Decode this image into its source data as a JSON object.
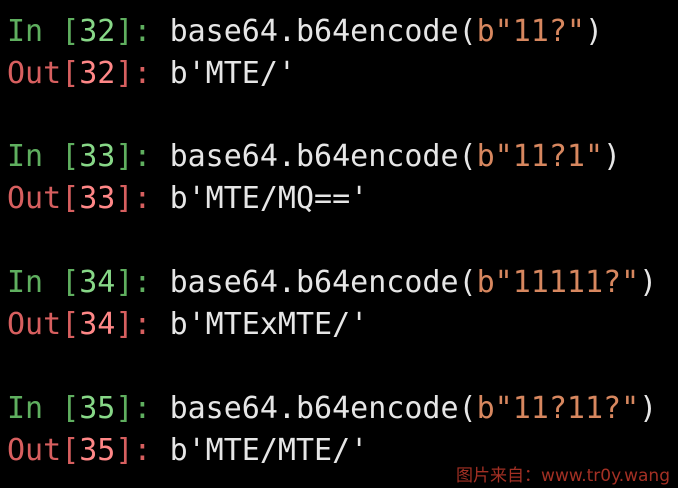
{
  "colors": {
    "background": "#000000",
    "prompt_in": "#5faf5f",
    "prompt_in_number": "#87d787",
    "prompt_out": "#d75f5f",
    "prompt_out_number": "#ff8787",
    "code": "#e6e6e6",
    "string_literal": "#d7875f",
    "watermark": "#c0392b"
  },
  "prompt_labels": {
    "in": "In",
    "out": "Out",
    "open_bracket": "[",
    "close_bracket": "]:",
    "space": " "
  },
  "cells": [
    {
      "number": "32",
      "input_code": "base64.b64encode(",
      "input_string": "b\"11?\"",
      "input_close": ")",
      "output": "b'MTE/'"
    },
    {
      "number": "33",
      "input_code": "base64.b64encode(",
      "input_string": "b\"11?1\"",
      "input_close": ")",
      "output": "b'MTE/MQ=='"
    },
    {
      "number": "34",
      "input_code": "base64.b64encode(",
      "input_string": "b\"11111?\"",
      "input_close": ")",
      "output": "b'MTExMTE/'"
    },
    {
      "number": "35",
      "input_code": "base64.b64encode(",
      "input_string": "b\"11?11?\"",
      "input_close": ")",
      "output": "b'MTE/MTE/'"
    }
  ],
  "watermark": "图片来自：www.tr0y.wang"
}
